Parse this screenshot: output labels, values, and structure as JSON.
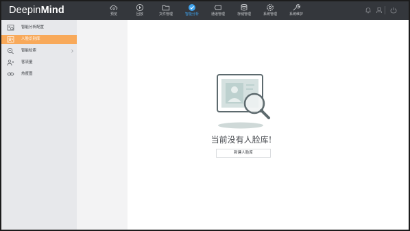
{
  "app": {
    "logo_light": "Deepin",
    "logo_bold": "Mind"
  },
  "nav": [
    {
      "label": "预览",
      "icon": "cloud-camera-icon",
      "active": false
    },
    {
      "label": "回放",
      "icon": "playback-icon",
      "active": false
    },
    {
      "label": "文件管理",
      "icon": "folder-icon",
      "active": false
    },
    {
      "label": "智能分析",
      "icon": "smart-analysis-icon",
      "active": true
    },
    {
      "label": "通道管理",
      "icon": "camera-channel-icon",
      "active": false
    },
    {
      "label": "存储管理",
      "icon": "database-icon",
      "active": false
    },
    {
      "label": "系统管理",
      "icon": "gear-icon",
      "active": false
    },
    {
      "label": "系统维护",
      "icon": "wrench-icon",
      "active": false
    }
  ],
  "topbar_right": [
    "bell-icon",
    "user-icon",
    "power-icon"
  ],
  "sidebar": [
    {
      "label": "智能分析配置",
      "icon": "analysis-config-icon",
      "active": false,
      "has_children": false
    },
    {
      "label": "人脸识别库",
      "icon": "face-library-icon",
      "active": true,
      "has_children": false
    },
    {
      "label": "智能检索",
      "icon": "smart-search-icon",
      "active": false,
      "has_children": true
    },
    {
      "label": "客流量",
      "icon": "people-flow-icon",
      "active": false,
      "has_children": false
    },
    {
      "label": "热度图",
      "icon": "heatmap-icon",
      "active": false,
      "has_children": false
    }
  ],
  "main": {
    "empty_message": "当前没有人脸库!",
    "create_button": "新建人脸库"
  },
  "colors": {
    "topbar": "#34373c",
    "active_nav": "#3fa3ee",
    "sidebar": "#e7e8eb",
    "sidebar_active": "#f8a95a"
  }
}
